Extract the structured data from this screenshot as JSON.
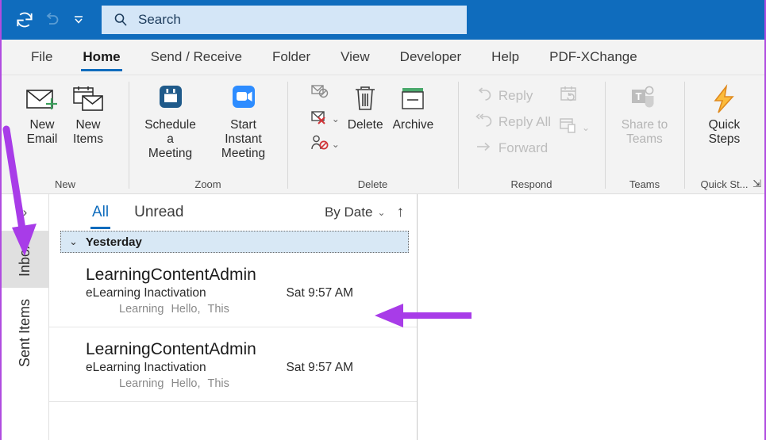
{
  "titlebar": {
    "sync_title": "Send/Receive All Folders",
    "undo_title": "Undo",
    "qat_chevron_title": "Customize Quick Access Toolbar",
    "search_placeholder": "Search",
    "search_value": "",
    "bg_color": "#0f6cbd",
    "search_bg_color": "#d4e6f7"
  },
  "tabs": [
    {
      "label": "File",
      "active": false
    },
    {
      "label": "Home",
      "active": true
    },
    {
      "label": "Send / Receive",
      "active": false
    },
    {
      "label": "Folder",
      "active": false
    },
    {
      "label": "View",
      "active": false
    },
    {
      "label": "Developer",
      "active": false
    },
    {
      "label": "Help",
      "active": false
    },
    {
      "label": "PDF-XChange",
      "active": false
    }
  ],
  "ribbon": {
    "accent_color": "#0f6cbd",
    "groups": [
      {
        "label": "New",
        "buttons": [
          {
            "label": "New\nEmail",
            "icon": "new-email-icon",
            "disabled": false,
            "has_chevron": false
          },
          {
            "label": "New\nItems",
            "icon": "new-items-icon",
            "disabled": false,
            "has_chevron": true
          }
        ]
      },
      {
        "label": "Zoom",
        "buttons": [
          {
            "label": "Schedule a\nMeeting",
            "icon": "zoom-calendar-icon",
            "disabled": false,
            "has_chevron": true
          },
          {
            "label": "Start Instant\nMeeting",
            "icon": "zoom-video-icon",
            "disabled": false,
            "has_chevron": true
          }
        ]
      },
      {
        "label": "Delete",
        "small_buttons": [
          {
            "name": "ignore-icon",
            "has_chevron": false
          },
          {
            "name": "junk-icon",
            "has_chevron": true
          },
          {
            "name": "block-sender-icon",
            "has_chevron": true
          }
        ],
        "buttons": [
          {
            "label": "Delete",
            "icon": "trash-icon",
            "disabled": false,
            "has_chevron": false
          },
          {
            "label": "Archive",
            "icon": "archive-icon",
            "disabled": false,
            "has_chevron": false
          }
        ]
      },
      {
        "label": "Respond",
        "items": [
          {
            "label": "Reply",
            "icon": "reply-icon",
            "disabled": true
          },
          {
            "label": "Reply All",
            "icon": "reply-all-icon",
            "disabled": true
          },
          {
            "label": "Forward",
            "icon": "forward-icon",
            "disabled": true
          }
        ],
        "side_icons": [
          {
            "name": "meeting-reply-icon",
            "has_chevron": false,
            "disabled": true
          },
          {
            "name": "more-respond-icon",
            "has_chevron": true,
            "disabled": true
          }
        ]
      },
      {
        "label": "Teams",
        "buttons": [
          {
            "label": "Share to\nTeams",
            "icon": "teams-icon",
            "disabled": true,
            "has_chevron": false
          }
        ]
      },
      {
        "label": "Quick St...",
        "has_dialog_launcher": true,
        "launcher_glyph": "⇲",
        "buttons": [
          {
            "label": "Quick\nSteps",
            "icon": "quick-steps-icon",
            "disabled": false,
            "has_chevron": true
          }
        ]
      }
    ]
  },
  "navrail": {
    "expand_glyph": "›",
    "items": [
      {
        "label": "Inbox",
        "selected": true
      },
      {
        "label": "Sent Items",
        "selected": false
      }
    ]
  },
  "list": {
    "filters": [
      {
        "label": "All",
        "active": true
      },
      {
        "label": "Unread",
        "active": false
      }
    ],
    "sort_label": "By Date",
    "sort_chevron": "⌄",
    "sort_direction_glyph": "↑",
    "group_header": {
      "label": "Yesterday",
      "chevron": "⌄",
      "bg_color": "#d8e8f5"
    },
    "messages": [
      {
        "sender": "LearningContentAdmin",
        "subject": "eLearning Inactivation",
        "date": "Sat 9:57 AM",
        "preview_parts": [
          "Learning",
          "Hello,",
          "This"
        ]
      },
      {
        "sender": "LearningContentAdmin",
        "subject": "eLearning Inactivation",
        "date": "Sat 9:57 AM",
        "preview_parts": [
          "Learning",
          "Hello,",
          "This"
        ]
      }
    ]
  },
  "annotations": {
    "color": "#a83ce8",
    "arrows": [
      {
        "name": "arrow-to-inbox",
        "direction": "down-right"
      },
      {
        "name": "arrow-to-message",
        "direction": "left"
      }
    ]
  }
}
